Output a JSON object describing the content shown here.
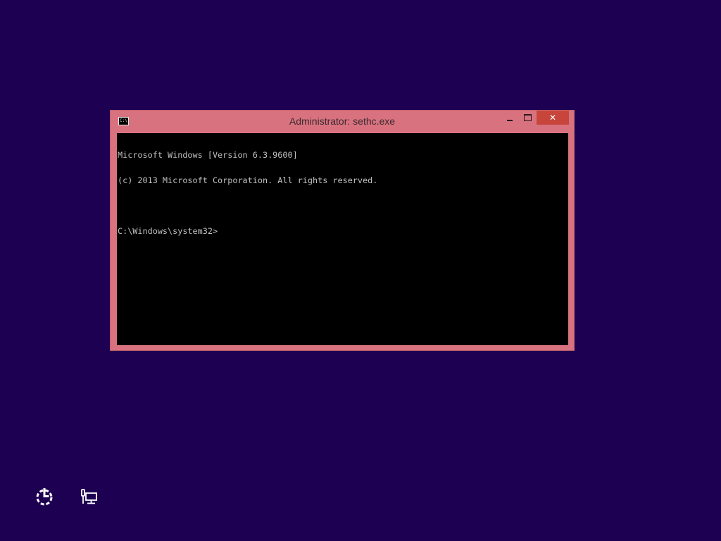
{
  "window": {
    "title": "Administrator: sethc.exe",
    "icon": "cmd-icon",
    "icon_text": "C:\\.",
    "close_glyph": "✕"
  },
  "console": {
    "lines": [
      "Microsoft Windows [Version 6.3.9600]",
      "(c) 2013 Microsoft Corporation. All rights reserved.",
      "",
      "C:\\Windows\\system32>"
    ]
  },
  "desktop": {
    "background_color": "#1e0053",
    "icons": [
      "ease-of-access-icon",
      "network-icon"
    ]
  },
  "colors": {
    "window_frame": "#d9727f",
    "close_button": "#c7453a",
    "console_bg": "#000000",
    "console_text": "#c0c0c0"
  }
}
